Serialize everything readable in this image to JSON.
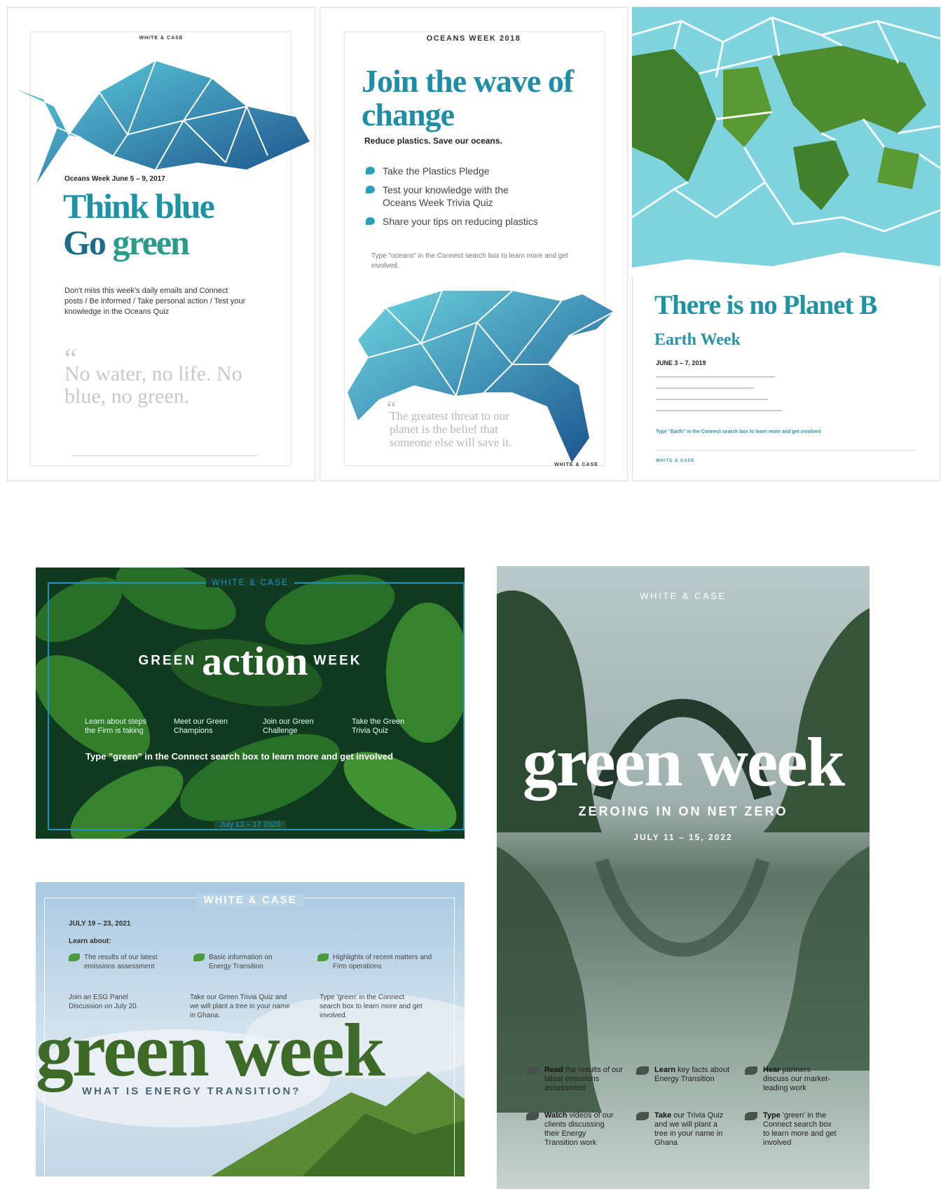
{
  "poster1": {
    "logo": "WHITE & CASE",
    "date_title": "Oceans Week June 5 – 9, 2017",
    "headline1": "Think blue",
    "headline2a": "Go ",
    "headline2b": "green",
    "body": "Don't miss this week's daily emails and Connect posts / Be informed / Take personal action / Test your knowledge in the Oceans Quiz",
    "quote_mark": "“",
    "quote": "No water, no life. No blue, no green."
  },
  "poster2": {
    "logo": "OCEANS WEEK 2018",
    "headline": "Join the wave of change",
    "subheadline": "Reduce plastics. Save our oceans.",
    "bullets": [
      "Take the Plastics Pledge",
      "Test your knowledge with the Oceans Week Trivia Quiz",
      "Share your tips on reducing plastics"
    ],
    "note": "Type \"oceans\" in the Connect search box to learn more and get involved.",
    "quote": "The greatest threat to our planet is the belief that someone else will save it.",
    "wc": "WHITE & CASE"
  },
  "poster3": {
    "headline": "There is no Planet B",
    "subtitle": "Earth Week",
    "date": "JUNE 3 – 7, 2019",
    "type_line": "Type \"Earth\" in the Connect search box to learn more and get involved",
    "wc": "WHITE & CASE"
  },
  "green_action": {
    "logo": "WHITE & CASE",
    "title_left": "GREEN",
    "title_big": "action",
    "title_right": "WEEK",
    "items": [
      "Learn about steps the Firm is taking",
      "Meet our Green Champions",
      "Join our Green Challenge",
      "Take the Green Trivia Quiz"
    ],
    "type_line": "Type \"green\" in the Connect search box to learn more and get involved",
    "date": "July 13 – 17 2020"
  },
  "green_week_2021": {
    "logo": "WHITE & CASE",
    "date": "JULY 19 – 23, 2021",
    "learn": "Learn about:",
    "learn_items": [
      "The results of our latest emissions assessment",
      "Basic information on Energy Transition",
      "Highlights of recent matters and Firm operations"
    ],
    "row2": [
      "Join an ESG Panel Discussion on July 20.",
      "Take our Green Trivia Quiz and we will plant a tree in your name in Ghana.",
      "Type 'green' in the Connect search box to learn more and get involved."
    ],
    "headline": "green week",
    "subheadline": "WHAT IS ENERGY TRANSITION?"
  },
  "green_week_2022": {
    "logo": "WHITE & CASE",
    "headline": "green week",
    "subheadline": "ZEROING IN ON NET ZERO",
    "date": "JULY 11 – 15, 2022",
    "items": [
      {
        "bold": "Read",
        "text": " the results of our latest emissions assessment"
      },
      {
        "bold": "Learn",
        "text": " key facts about Energy Transition"
      },
      {
        "bold": "Hear",
        "text": " partners discuss our market-leading work"
      },
      {
        "bold": "Watch",
        "text": " videos of our clients discussing their Energy Transition work"
      },
      {
        "bold": "Take",
        "text": " our Trivia Quiz and we will plant a tree in your name in Ghana"
      },
      {
        "bold": "Type",
        "text": " 'green' in the Connect search box to learn more and get involved"
      }
    ]
  }
}
